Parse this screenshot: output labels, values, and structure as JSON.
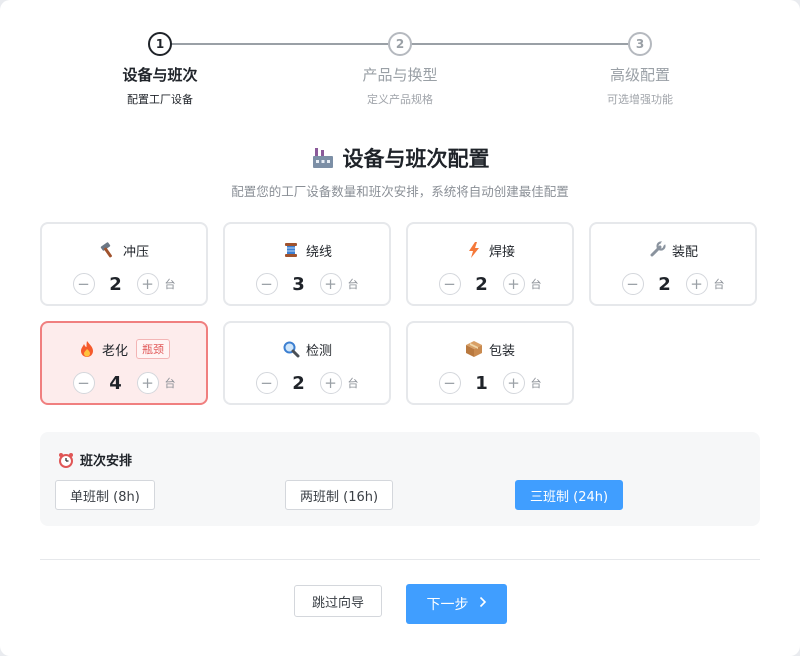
{
  "steps": [
    {
      "number": "1",
      "title": "设备与班次",
      "subtitle": "配置工厂设备"
    },
    {
      "number": "2",
      "title": "产品与换型",
      "subtitle": "定义产品规格"
    },
    {
      "number": "3",
      "title": "高级配置",
      "subtitle": "可选增强功能"
    }
  ],
  "header": {
    "title": "设备与班次配置",
    "subtitle": "配置您的工厂设备数量和班次安排，系统将自动创建最佳配置"
  },
  "equipment": [
    {
      "name": "冲压",
      "count": "2",
      "unit": "台",
      "icon": "hammer-icon"
    },
    {
      "name": "绕线",
      "count": "3",
      "unit": "台",
      "icon": "spool-icon"
    },
    {
      "name": "焊接",
      "count": "2",
      "unit": "台",
      "icon": "lightning-icon"
    },
    {
      "name": "装配",
      "count": "2",
      "unit": "台",
      "icon": "wrench-icon"
    },
    {
      "name": "老化",
      "count": "4",
      "unit": "台",
      "icon": "fire-icon",
      "badge": "瓶颈"
    },
    {
      "name": "检测",
      "count": "2",
      "unit": "台",
      "icon": "magnifier-icon"
    },
    {
      "name": "包装",
      "count": "1",
      "unit": "台",
      "icon": "package-icon"
    }
  ],
  "stepper": {
    "minus": "−",
    "plus": "+"
  },
  "shift": {
    "title": "班次安排",
    "options": [
      "单班制 (8h)",
      "两班制 (16h)",
      "三班制 (24h)"
    ],
    "selected": "三班制 (24h)"
  },
  "actions": {
    "skip": "跳过向导",
    "next": "下一步",
    "next_icon": "chevron-right-icon"
  },
  "colors": {
    "primary": "#409eff",
    "bottleneck_border": "#f07f7f",
    "bottleneck_bg": "#fdecec"
  }
}
